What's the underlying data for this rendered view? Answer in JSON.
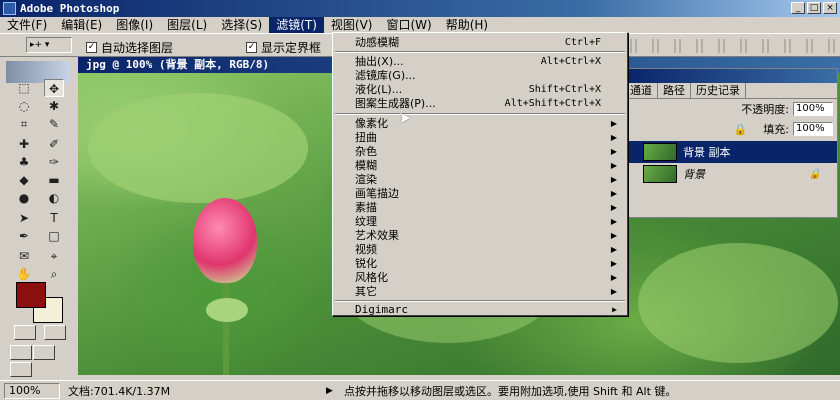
{
  "window": {
    "title": "Adobe Photoshop"
  },
  "menu": [
    "文件(F)",
    "编辑(E)",
    "图像(I)",
    "图层(L)",
    "选择(S)",
    "滤镜(T)",
    "视图(V)",
    "窗口(W)",
    "帮助(H)"
  ],
  "options": {
    "auto_select": "自动选择图层",
    "show_bounds": "显示定界框"
  },
  "document": {
    "title": "jpg @ 100% (背景 副本, RGB/8)"
  },
  "filter_menu": {
    "last": {
      "label": "动感模糊",
      "shortcut": "Ctrl+F"
    },
    "group1": [
      {
        "label": "抽出(X)...",
        "shortcut": "Alt+Ctrl+X"
      },
      {
        "label": "滤镜库(G)...",
        "shortcut": ""
      },
      {
        "label": "液化(L)...",
        "shortcut": "Shift+Ctrl+X"
      },
      {
        "label": "图案生成器(P)...",
        "shortcut": "Alt+Shift+Ctrl+X"
      }
    ],
    "group2": [
      "像素化",
      "扭曲",
      "杂色",
      "模糊",
      "渲染",
      "画笔描边",
      "素描",
      "纹理",
      "艺术效果",
      "视频",
      "锐化",
      "风格化",
      "其它"
    ],
    "group3": [
      "Digimarc"
    ]
  },
  "layers_panel": {
    "tabs": [
      "通道",
      "路径",
      "历史记录"
    ],
    "opacity_label": "不透明度:",
    "opacity_value": "100%",
    "fill_label": "填充:",
    "fill_value": "100%",
    "layers": [
      {
        "name": "背景 副本",
        "selected": true
      },
      {
        "name": "背景",
        "selected": false
      }
    ]
  },
  "status": {
    "zoom": "100%",
    "doc_size": "文档:701.4K/1.37M",
    "hint": "点按并拖移以移动图层或选区。要用附加选项,使用 Shift 和 Alt 键。"
  },
  "colors": {
    "foreground": "#8b0f0f",
    "background": "#f4f0d8",
    "titlebar": "#0a246a"
  }
}
